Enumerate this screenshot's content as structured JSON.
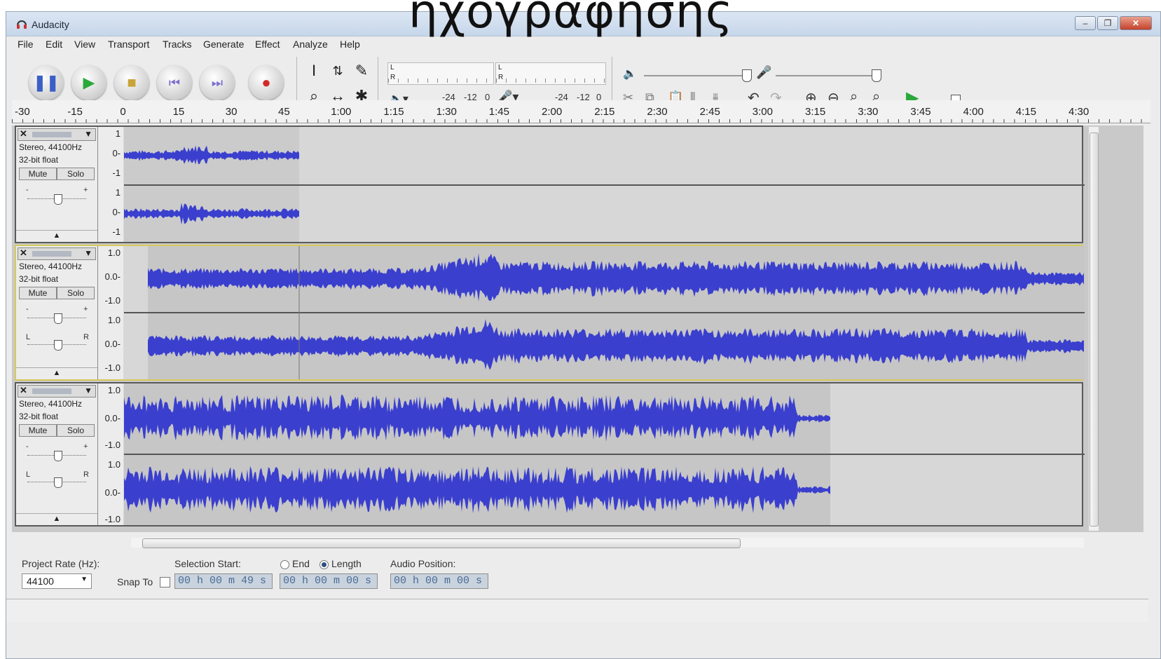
{
  "caption": "ηχογράφησης",
  "window": {
    "title": "Audacity",
    "min_label": "–",
    "max_label": "❐",
    "close_label": "✕"
  },
  "menu": [
    "File",
    "Edit",
    "View",
    "Transport",
    "Tracks",
    "Generate",
    "Effect",
    "Analyze",
    "Help"
  ],
  "meters": {
    "play_L": "L",
    "play_R": "R",
    "rec_L": "L",
    "rec_R": "R",
    "play_scale": [
      "-24",
      "-12",
      "0"
    ],
    "rec_scale": [
      "-24",
      "-12",
      "0"
    ]
  },
  "ruler": [
    "-30",
    "-15",
    "0",
    "15",
    "30",
    "45",
    "1:00",
    "1:15",
    "1:30",
    "1:45",
    "2:00",
    "2:15",
    "2:30",
    "2:45",
    "3:00",
    "3:15",
    "3:30",
    "3:45",
    "4:00",
    "4:15",
    "4:30"
  ],
  "tracks": [
    {
      "info1": "Stereo, 44100Hz",
      "info2": "32-bit float",
      "mute": "Mute",
      "solo": "Solo",
      "scale_top": [
        "1",
        "0-",
        "-1"
      ],
      "scale_bottom": [
        "1",
        "0-",
        "-1"
      ],
      "selected": false
    },
    {
      "info1": "Stereo, 44100Hz",
      "info2": "32-bit float",
      "mute": "Mute",
      "solo": "Solo",
      "scale_top": [
        "1.0",
        "0.0-",
        "-1.0"
      ],
      "scale_bottom": [
        "1.0",
        "0.0-",
        "-1.0"
      ],
      "selected": true
    },
    {
      "info1": "Stereo, 44100Hz",
      "info2": "32-bit float",
      "mute": "Mute",
      "solo": "Solo",
      "scale_top": [
        "1.0",
        "0.0-",
        "-1.0"
      ],
      "scale_bottom": [
        "1.0",
        "0.0-",
        "-1.0"
      ],
      "selected": false
    }
  ],
  "pan": {
    "left": "L",
    "right": "R",
    "minus": "-",
    "plus": "+"
  },
  "status": {
    "project_rate_label": "Project Rate (Hz):",
    "project_rate_value": "44100",
    "snap_label": "Snap To",
    "selection_start_label": "Selection Start:",
    "end_label": "End",
    "length_label": "Length",
    "selection_start_value": "00 h 00 m 49 s",
    "length_value": "00 h 00 m 00 s",
    "audio_position_label": "Audio Position:",
    "audio_position_value": "00 h 00 m 00 s"
  },
  "colors": {
    "waveform": "#3a3fce",
    "selection_border": "#d6c95b",
    "titlebar": "#c6d6ea"
  }
}
